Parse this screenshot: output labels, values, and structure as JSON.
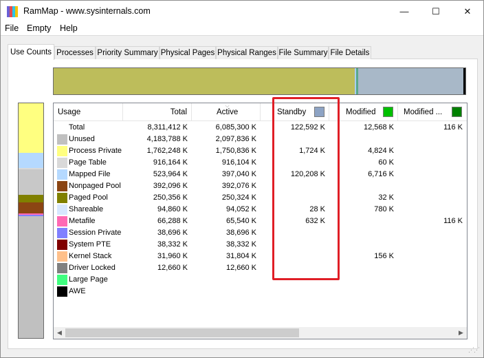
{
  "window": {
    "title": "RamMap - www.sysinternals.com",
    "icon_colors": [
      "#6b5fd6",
      "#e84b4b",
      "#2ec4e8",
      "#f5c400"
    ],
    "minimize_label": "—",
    "maximize_label": "☐",
    "close_label": "✕"
  },
  "menu": [
    "File",
    "Empty",
    "Help"
  ],
  "tabs": [
    "Use Counts",
    "Processes",
    "Priority Summary",
    "Physical Pages",
    "Physical Ranges",
    "File Summary",
    "File Details"
  ],
  "active_tab": "Use Counts",
  "memory_bar": [
    {
      "name": "Active",
      "color": "#bdbd5b",
      "fraction": 0.732
    },
    {
      "name": "Mapped File",
      "color": "#a9cff3",
      "fraction": 0.003
    },
    {
      "name": "Unused (metafile)",
      "color": "#5aa88a",
      "fraction": 0.005
    },
    {
      "name": "Standby",
      "color": "#a8b8c8",
      "fraction": 0.255
    },
    {
      "name": "AWE",
      "color": "#000000",
      "fraction": 0.005
    }
  ],
  "usage_bar": [
    {
      "name": "Process Private",
      "color": "#ffff80",
      "fraction": 0.212
    },
    {
      "name": "Mapped File",
      "color": "#b5d9ff",
      "fraction": 0.063
    },
    {
      "name": "Page Table",
      "color": "#d9d9d9",
      "fraction": 0.006
    },
    {
      "name": "Unused",
      "color": "#c8c8c8",
      "fraction": 0.11
    },
    {
      "name": "Paged Pool",
      "color": "#808000",
      "fraction": 0.03
    },
    {
      "name": "Nonpaged Pool",
      "color": "#8b4513",
      "fraction": 0.047
    },
    {
      "name": "Metafile",
      "color": "#ff69b4",
      "fraction": 0.008
    },
    {
      "name": "Session Private",
      "color": "#8080ff",
      "fraction": 0.005
    },
    {
      "name": "Unused",
      "color": "#c0c0c0",
      "fraction": 0.519
    }
  ],
  "columns": [
    {
      "label": "Usage"
    },
    {
      "label": "Total"
    },
    {
      "label": "Active",
      "sorted": true
    },
    {
      "label": "Standby",
      "swatch": "#8da3c4"
    },
    {
      "label": "Modified",
      "swatch": "#00c000"
    },
    {
      "label": "Modified ...",
      "swatch": "#008000"
    }
  ],
  "rows": [
    {
      "usage": "Total",
      "color": null,
      "total": "8,311,412 K",
      "active": "6,085,300 K",
      "standby": "122,592 K",
      "modified": "12,568 K",
      "modified_nw": "116 K"
    },
    {
      "usage": "Unused",
      "color": "#c0c0c0",
      "total": "4,183,788 K",
      "active": "2,097,836 K",
      "standby": "",
      "modified": "",
      "modified_nw": ""
    },
    {
      "usage": "Process Private",
      "color": "#ffff80",
      "total": "1,762,248 K",
      "active": "1,750,836 K",
      "standby": "1,724 K",
      "modified": "4,824 K",
      "modified_nw": ""
    },
    {
      "usage": "Page Table",
      "color": "#d9d9d9",
      "total": "916,164 K",
      "active": "916,104 K",
      "standby": "",
      "modified": "60 K",
      "modified_nw": ""
    },
    {
      "usage": "Mapped File",
      "color": "#b5d9ff",
      "total": "523,964 K",
      "active": "397,040 K",
      "standby": "120,208 K",
      "modified": "6,716 K",
      "modified_nw": ""
    },
    {
      "usage": "Nonpaged Pool",
      "color": "#8b4513",
      "total": "392,096 K",
      "active": "392,076 K",
      "standby": "",
      "modified": "",
      "modified_nw": ""
    },
    {
      "usage": "Paged Pool",
      "color": "#808000",
      "total": "250,356 K",
      "active": "250,324 K",
      "standby": "",
      "modified": "32 K",
      "modified_nw": ""
    },
    {
      "usage": "Shareable",
      "color": "#d7e7ff",
      "total": "94,860 K",
      "active": "94,052 K",
      "standby": "28 K",
      "modified": "780 K",
      "modified_nw": ""
    },
    {
      "usage": "Metafile",
      "color": "#ff69b4",
      "total": "66,288 K",
      "active": "65,540 K",
      "standby": "632 K",
      "modified": "",
      "modified_nw": "116 K"
    },
    {
      "usage": "Session Private",
      "color": "#8080ff",
      "total": "38,696 K",
      "active": "38,696 K",
      "standby": "",
      "modified": "",
      "modified_nw": ""
    },
    {
      "usage": "System PTE",
      "color": "#800000",
      "total": "38,332 K",
      "active": "38,332 K",
      "standby": "",
      "modified": "",
      "modified_nw": ""
    },
    {
      "usage": "Kernel Stack",
      "color": "#ffc08a",
      "total": "31,960 K",
      "active": "31,804 K",
      "standby": "",
      "modified": "156 K",
      "modified_nw": ""
    },
    {
      "usage": "Driver Locked",
      "color": "#808080",
      "total": "12,660 K",
      "active": "12,660 K",
      "standby": "",
      "modified": "",
      "modified_nw": ""
    },
    {
      "usage": "Large Page",
      "color": "#40ff80",
      "total": "",
      "active": "",
      "standby": "",
      "modified": "",
      "modified_nw": ""
    },
    {
      "usage": "AWE",
      "color": "#000000",
      "total": "",
      "active": "",
      "standby": "",
      "modified": "",
      "modified_nw": ""
    }
  ],
  "scrollbar": {
    "left_arrow": "◀",
    "right_arrow": "▶"
  },
  "highlight_color": "#e01e26"
}
